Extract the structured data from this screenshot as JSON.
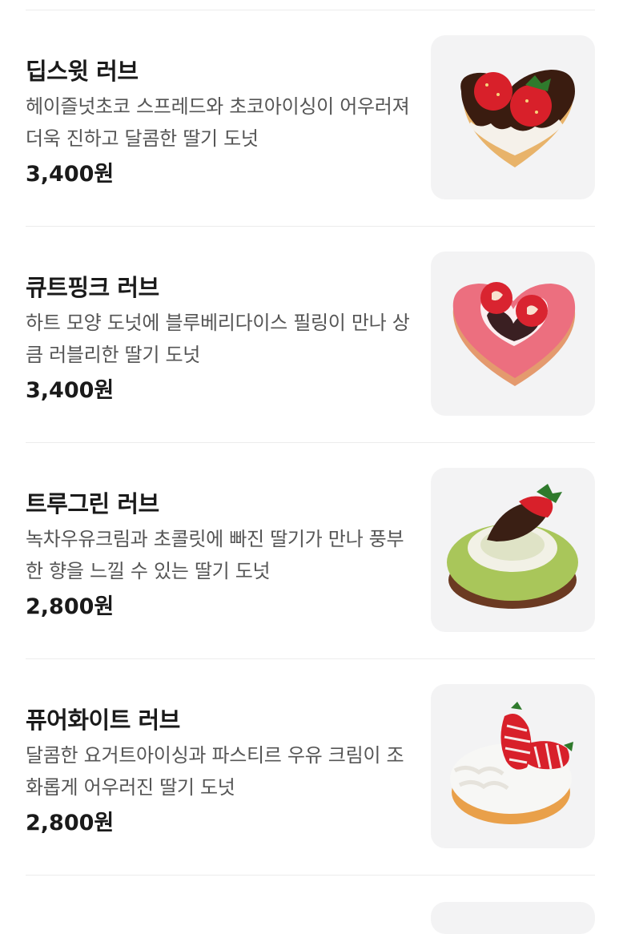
{
  "items": [
    {
      "name": "딥스윗 러브",
      "description": "헤이즐넛초코 스프레드와 초코아이싱이 어우러져 더욱 진하고 달콤한 딸기 도넛",
      "price": "3,400원",
      "image": "heart-chocolate-donut-strawberry"
    },
    {
      "name": "큐트핑크 러브",
      "description": "하트 모양 도넛에 블루베리다이스 필링이 만나 상큼 러블리한 딸기 도넛",
      "price": "3,400원",
      "image": "heart-pink-donut-strawberry"
    },
    {
      "name": "트루그린 러브",
      "description": "녹차우유크림과 초콜릿에 빠진 딸기가 만나 풍부한 향을 느낄 수 있는 딸기 도넛",
      "price": "2,800원",
      "image": "green-tea-donut-choco-strawberry"
    },
    {
      "name": "퓨어화이트 러브",
      "description": "달콤한 요거트아이싱과 파스티르 우유 크림이 조화롭게 어우러진 딸기 도넛",
      "price": "2,800원",
      "image": "white-yogurt-donut-striped-strawberry"
    }
  ]
}
